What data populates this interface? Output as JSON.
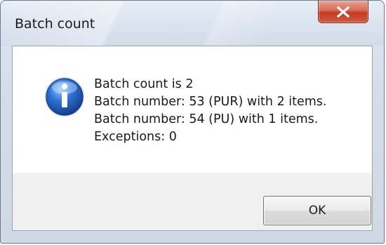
{
  "window": {
    "title": "Batch count",
    "close_icon": "close-icon"
  },
  "message": {
    "icon": "info-icon",
    "lines": [
      "Batch count is 2",
      "Batch number: 53 (PUR) with 2 items.",
      "Batch number: 54 (PU) with 1 items.",
      "Exceptions: 0"
    ]
  },
  "buttons": {
    "ok_label": "OK"
  },
  "colors": {
    "close_button": "#c43a22",
    "info_icon_blue": "#1f5fbf"
  }
}
